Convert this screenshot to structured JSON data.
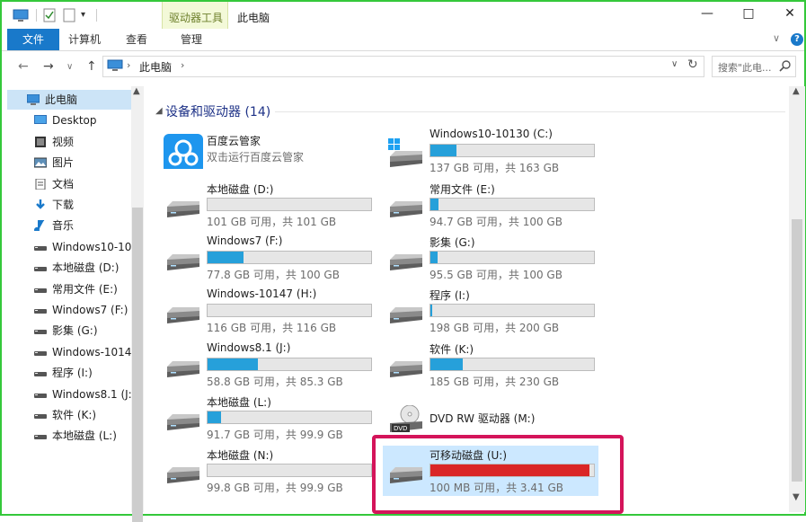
{
  "window": {
    "title": "此电脑",
    "context_tab_title": "驱动器工具",
    "min_glyph": "—",
    "max_glyph": "□",
    "close_glyph": "✕"
  },
  "ribbon": {
    "tabs": [
      "文件",
      "计算机",
      "查看",
      "管理"
    ],
    "help_glyph": "?",
    "collapse_glyph": "∨"
  },
  "address": {
    "path": "此电脑",
    "sep": "›",
    "search_placeholder": "搜索\"此电...",
    "refresh_glyph": "↻",
    "dropdown_glyph": "∨"
  },
  "sidebar": {
    "items": [
      {
        "label": "此电脑",
        "icon": "pc-icon"
      },
      {
        "label": "Desktop",
        "icon": "desktop-icon"
      },
      {
        "label": "视频",
        "icon": "video-icon"
      },
      {
        "label": "图片",
        "icon": "picture-icon"
      },
      {
        "label": "文档",
        "icon": "document-icon"
      },
      {
        "label": "下载",
        "icon": "download-icon"
      },
      {
        "label": "音乐",
        "icon": "music-icon"
      },
      {
        "label": "Windows10-10",
        "icon": "drive-icon"
      },
      {
        "label": "本地磁盘 (D:)",
        "icon": "drive-icon"
      },
      {
        "label": "常用文件 (E:)",
        "icon": "drive-icon"
      },
      {
        "label": "Windows7 (F:)",
        "icon": "drive-icon"
      },
      {
        "label": "影集 (G:)",
        "icon": "drive-icon"
      },
      {
        "label": "Windows-1014",
        "icon": "drive-icon"
      },
      {
        "label": "程序 (I:)",
        "icon": "drive-icon"
      },
      {
        "label": "Windows8.1 (J:",
        "icon": "drive-icon"
      },
      {
        "label": "软件 (K:)",
        "icon": "drive-icon"
      },
      {
        "label": "本地磁盘 (L:)",
        "icon": "drive-icon"
      }
    ]
  },
  "main": {
    "group_title": "设备和驱动器 (14)",
    "app": {
      "name": "百度云管家",
      "sub": "双击运行百度云管家"
    },
    "drives": [
      {
        "name": "Windows10-10130 (C:)",
        "info": "137 GB 可用，共 163 GB",
        "used": 0.16,
        "icon": "windows-drive-icon"
      },
      {
        "name": "本地磁盘 (D:)",
        "info": "101 GB 可用，共 101 GB",
        "used": 0.0,
        "icon": "drive-icon"
      },
      {
        "name": "常用文件 (E:)",
        "info": "94.7 GB 可用，共 100 GB",
        "used": 0.05,
        "icon": "drive-icon"
      },
      {
        "name": "Windows7 (F:)",
        "info": "77.8 GB 可用，共 100 GB",
        "used": 0.22,
        "icon": "drive-icon"
      },
      {
        "name": "影集 (G:)",
        "info": "95.5 GB 可用，共 100 GB",
        "used": 0.045,
        "icon": "drive-icon"
      },
      {
        "name": "Windows-10147 (H:)",
        "info": "116 GB 可用，共 116 GB",
        "used": 0.0,
        "icon": "drive-icon"
      },
      {
        "name": "程序 (I:)",
        "info": "198 GB 可用，共 200 GB",
        "used": 0.01,
        "icon": "drive-icon"
      },
      {
        "name": "Windows8.1 (J:)",
        "info": "58.8 GB 可用，共 85.3 GB",
        "used": 0.31,
        "icon": "drive-icon"
      },
      {
        "name": "软件 (K:)",
        "info": "185 GB 可用，共 230 GB",
        "used": 0.2,
        "icon": "drive-icon"
      },
      {
        "name": "本地磁盘 (L:)",
        "info": "91.7 GB 可用，共 99.9 GB",
        "used": 0.08,
        "icon": "drive-icon"
      },
      {
        "name": "DVD RW 驱动器 (M:)",
        "info": "",
        "used": null,
        "icon": "dvd-drive-icon"
      },
      {
        "name": "本地磁盘 (N:)",
        "info": "99.8 GB 可用，共 99.9 GB",
        "used": 0.0,
        "icon": "drive-icon"
      },
      {
        "name": "可移动磁盘 (U:)",
        "info": "100 MB 可用，共 3.41 GB",
        "used": 0.97,
        "icon": "removable-drive-icon",
        "selected": true
      }
    ],
    "colors": {
      "bar_fill": "#26a0da",
      "bar_full": "#da2626",
      "highlight_border": "#d4145a",
      "selection": "#cce8ff"
    }
  }
}
